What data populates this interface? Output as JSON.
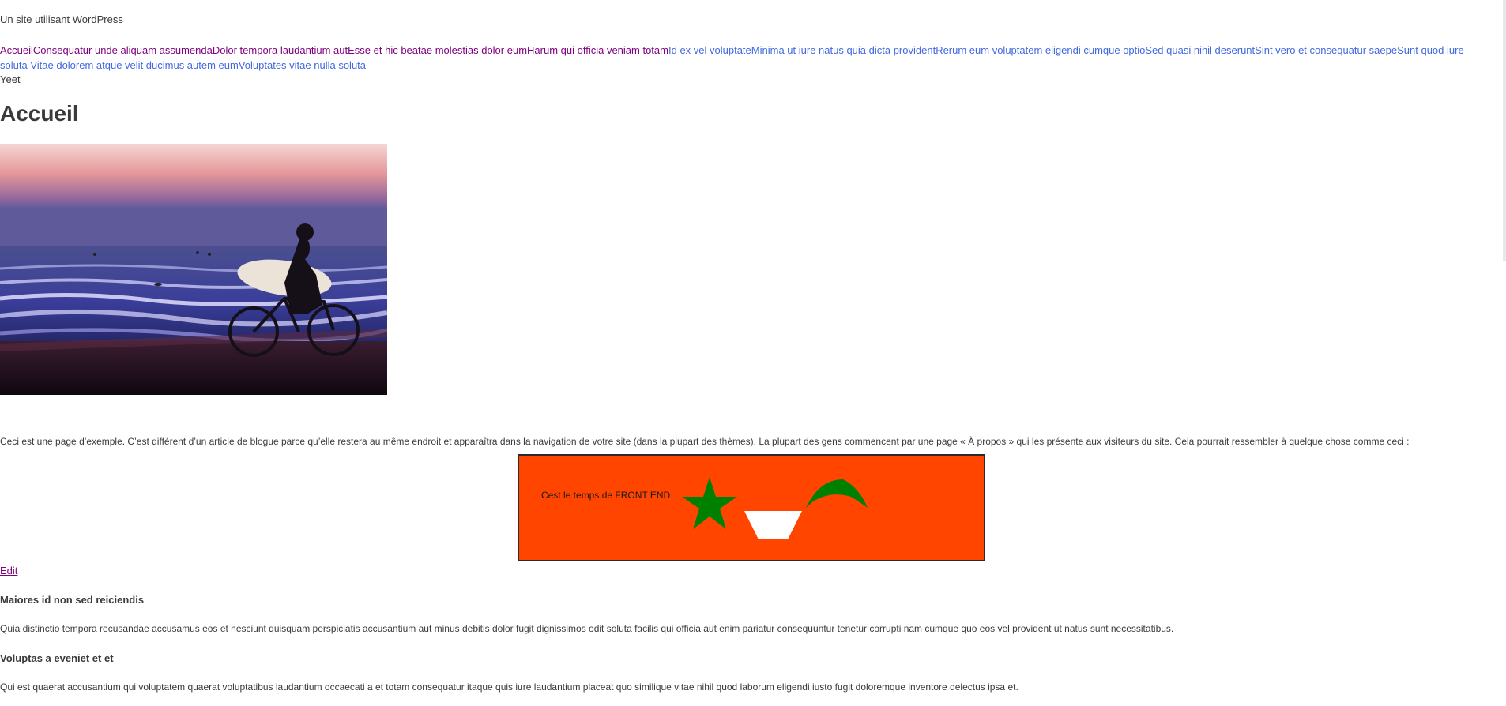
{
  "site": {
    "description": "Un site utilisant WordPress"
  },
  "nav": {
    "items": [
      {
        "label": "Accueil",
        "visited": true
      },
      {
        "label": "Consequatur unde aliquam assumenda",
        "visited": true
      },
      {
        "label": "Dolor tempora laudantium aut",
        "visited": true
      },
      {
        "label": "Esse et hic beatae molestias dolor eum",
        "visited": true
      },
      {
        "label": "Harum qui officia veniam totam",
        "visited": true
      },
      {
        "label": "Id ex vel voluptate",
        "visited": false
      },
      {
        "label": "Minima ut iure natus quia dicta provident",
        "visited": false
      },
      {
        "label": "Rerum eum voluptatem eligendi cumque optio",
        "visited": false
      },
      {
        "label": "Sed quasi nihil deserunt",
        "visited": false
      },
      {
        "label": "Sint vero et consequatur saepe",
        "visited": false
      },
      {
        "label": "Sunt quod iure soluta",
        "visited": false
      },
      {
        "label": "Vitae dolorem atque velit ducimus autem eum",
        "visited": false
      },
      {
        "label": "Voluptates vitae nulla soluta",
        "visited": false
      }
    ],
    "colors": {
      "visited": "#800080",
      "unvisited": "#4169e1"
    }
  },
  "extra_text": "Yeet",
  "page": {
    "title": "Accueil",
    "intro": "Ceci est une page d’exemple. C’est différent d’un article de blogue parce qu’elle restera au même endroit et apparaîtra dans la navigation de votre site (dans la plupart des thèmes). La plupart des gens commencent par une page « À propos » qui les présente aux visiteurs du site. Cela pourrait ressembler à quelque chose comme ceci :",
    "edit_label": "Edit"
  },
  "banner": {
    "text": "Cest le temps de FRONT END",
    "background": "#ff4500",
    "shape_color": "#008000"
  },
  "sections": [
    {
      "heading": "Maiores id non sed reiciendis",
      "body": "Quia distinctio tempora recusandae accusamus eos et nesciunt quisquam perspiciatis accusantium aut minus debitis dolor fugit dignissimos odit soluta facilis qui officia aut enim pariatur consequuntur tenetur corrupti nam cumque quo eos vel provident ut natus sunt necessitatibus."
    },
    {
      "heading": "Voluptas a eveniet et et",
      "body": "Qui est quaerat accusantium qui voluptatem quaerat voluptatibus laudantium occaecati a et totam consequatur itaque quis iure laudantium placeat quo similique vitae nihil quod laborum eligendi iusto fugit doloremque inventore delectus ipsa et."
    }
  ]
}
